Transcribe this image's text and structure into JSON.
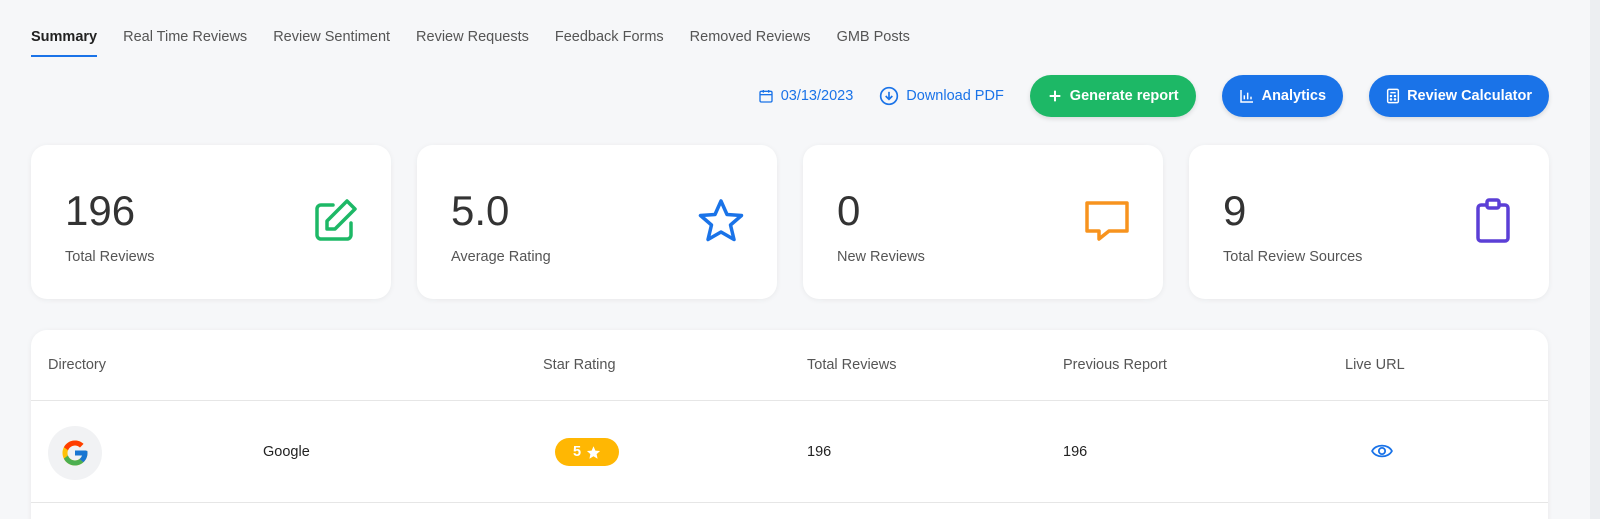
{
  "tabs": [
    {
      "label": "Summary",
      "active": true
    },
    {
      "label": "Real Time Reviews"
    },
    {
      "label": "Review Sentiment"
    },
    {
      "label": "Review Requests"
    },
    {
      "label": "Feedback Forms"
    },
    {
      "label": "Removed Reviews"
    },
    {
      "label": "GMB Posts"
    }
  ],
  "actions": {
    "date": "03/13/2023",
    "download_label": "Download PDF",
    "generate_label": "Generate report",
    "analytics_label": "Analytics",
    "calculator_label": "Review Calculator"
  },
  "cards": [
    {
      "value": "196",
      "label": "Total Reviews",
      "icon": "edit-icon",
      "color": "#1db866"
    },
    {
      "value": "5.0",
      "label": "Average Rating",
      "icon": "star-icon",
      "color": "#1a73e8"
    },
    {
      "value": "0",
      "label": "New Reviews",
      "icon": "chat-icon",
      "color": "#f7931e"
    },
    {
      "value": "9",
      "label": "Total Review Sources",
      "icon": "clipboard-icon",
      "color": "#5b3fd6"
    }
  ],
  "table": {
    "headers": [
      "Directory",
      "Star Rating",
      "Total Reviews",
      "Previous Report",
      "Live URL"
    ],
    "rows": [
      {
        "directory": "Google",
        "rating": "5",
        "total": "196",
        "previous": "196",
        "live_icon": "eye-icon"
      }
    ]
  },
  "colors": {
    "accent": "#1a73e8",
    "green": "#1db866",
    "badge": "#ffb703"
  }
}
